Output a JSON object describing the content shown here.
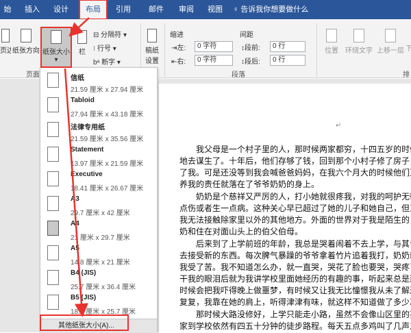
{
  "tabs": [
    {
      "label": "始"
    },
    {
      "label": "插入"
    },
    {
      "label": "设计"
    },
    {
      "label": "布局"
    },
    {
      "label": "引用"
    },
    {
      "label": "邮件"
    },
    {
      "label": "审阅"
    },
    {
      "label": "视图"
    }
  ],
  "tell_me": "♀ 告诉我你想要做什么",
  "ribbon": {
    "margins": "页边距",
    "orientation": "纸张方向",
    "size": "纸张大小",
    "columns": "栏",
    "breaks": "分隔符",
    "line_numbers": "行号",
    "hyphenation": "断字",
    "page_setup_group": "页面",
    "draft_paper": "稿纸",
    "draft_setup": "设置",
    "indent_label": "缩进",
    "indent_left_label": "左:",
    "indent_left_value": "0 字符",
    "indent_right_label": "右:",
    "indent_right_value": "0 字符",
    "spacing_label": "间距",
    "spacing_before_label": "段前:",
    "spacing_before_value": "0 行",
    "spacing_after_label": "段后:",
    "spacing_after_value": "0 行",
    "paragraph_group": "段落",
    "position": "位置",
    "wrap_text": "环绕文字",
    "bring_forward": "上移一层",
    "arrange": "下",
    "arrange_group": "排"
  },
  "paper_sizes": [
    {
      "name": "信纸",
      "dims": "21.59 厘米 x 27.94 厘米"
    },
    {
      "name": "Tabloid",
      "dims": "27.94 厘米 x 43.18 厘米"
    },
    {
      "name": "法律专用纸",
      "dims": "21.59 厘米 x 35.56 厘米"
    },
    {
      "name": "Statement",
      "dims": "13.97 厘米 x 21.59 厘米"
    },
    {
      "name": "Executive",
      "dims": "18.41 厘米 x 26.67 厘米"
    },
    {
      "name": "A3",
      "dims": "29.7 厘米 x 42 厘米"
    },
    {
      "name": "A4",
      "dims": "21 厘米 x 29.7 厘米"
    },
    {
      "name": "A5",
      "dims": "14.8 厘米 x 21 厘米"
    },
    {
      "name": "B4 (JIS)",
      "dims": "25.7 厘米 x 36.4 厘米"
    },
    {
      "name": "B5 (JIS)",
      "dims": "18.2 厘米 x 25.7 厘米"
    }
  ],
  "more_sizes": "其他纸张大小(A)...",
  "selected_paper": "A4",
  "document": {
    "lines": [
      "我父母是一个村子里的人，那时候两家都穷，十四五岁的时候",
      "地去谋生了。十年后，他们存够了钱，回到那个小村子修了房子，",
      "了我。可是还没等到我会喊爸爸妈妈，在我六个月大的时候他们又",
      "养我的责任就落在了爷爷奶奶的身上。",
      "奶奶是个慈祥又严厉的人，打小她就很疼我，对我的呵护无微不",
      "点伤或者生一点病。这种关心早已超过了她的儿子和她自己，但正是",
      "我无法接触除家里以外的其他地方。外面的世界对于我是陌生的，我",
      "奶和住在对面山头上的伯父伯母。",
      "后来到了上学前班的年龄，我总是哭着闹着不去上学，与其说",
      "去接受新的东西。每次脾气暴躁的爷爷拿着竹片追着我打，奶奶就会",
      "我受了苦。我不知道怎么办，就一直哭，哭花了脸也要哭，哭疼了脑",
      "干我的眼泪后就为我讲学校里面她经历的有趣的事，听起来总是那么",
      "时候会把我吓得晚上做噩梦，有时候又让我无比憧憬我从未了解过的",
      "复复，我靠在她的肩上，听得津津有味，就这样不知道做了多少次",
      "那时候大路没修好，上学只能走小路，虽然不会像山区里的孩子",
      "家到学校依然有四五十分钟的徒步路程。每天五点多鸡叫了几声之"
    ]
  }
}
